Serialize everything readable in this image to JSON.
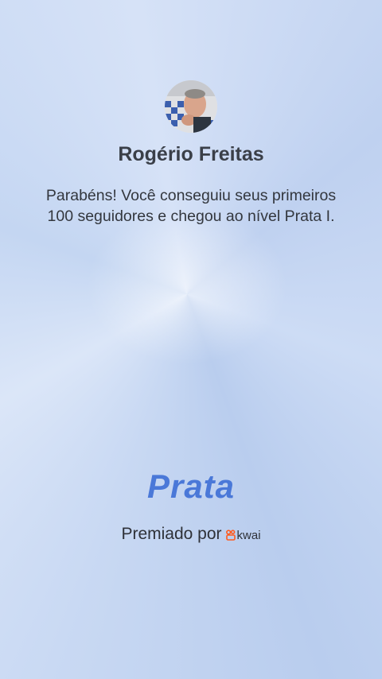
{
  "profile": {
    "name": "Rogério Freitas"
  },
  "message": "Parabéns! Você conseguiu seus primeiros 100 seguidores e chegou ao nível Prata I.",
  "level": "Prata",
  "award": {
    "label": "Premiado por",
    "brand": "kwai",
    "brand_icon": "kwai-logo-icon"
  },
  "colors": {
    "level_text": "#4a78d8",
    "brand_icon": "#ff5a1f",
    "background": "#c9d9f3"
  }
}
